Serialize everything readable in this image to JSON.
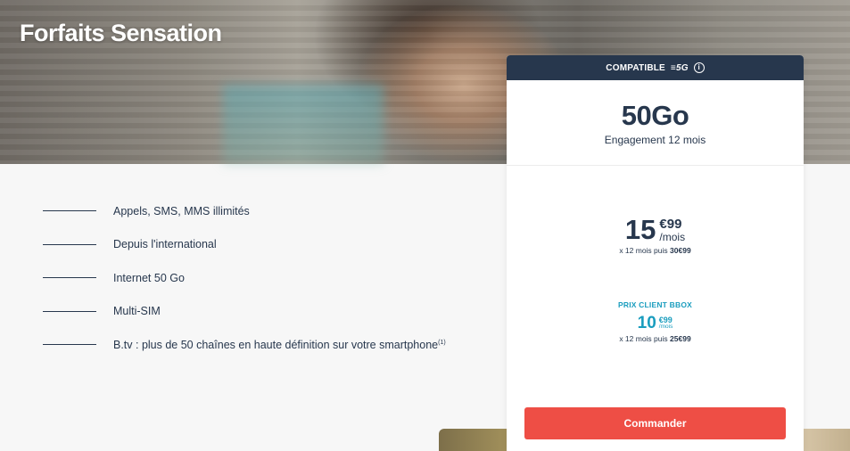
{
  "hero": {
    "title": "Forfaits Sensation"
  },
  "features": [
    {
      "label": "Appels, SMS, MMS illimités"
    },
    {
      "label": "Depuis l'international"
    },
    {
      "label": "Internet 50 Go"
    },
    {
      "label": "Multi-SIM"
    },
    {
      "label": "B.tv : plus de 50 chaînes en haute définition sur votre smartphone",
      "footnote": "(1)"
    }
  ],
  "card": {
    "header": {
      "compatible_label": "COMPATIBLE",
      "network_label": "≡5G",
      "info_icon": "i"
    },
    "data_amount": "50Go",
    "engagement": "Engagement 12 mois",
    "price": {
      "main": "15",
      "cents": "€99",
      "unit": "/mois",
      "note_prefix": "x 12 mois puis",
      "note_after": "30€99"
    },
    "client_price": {
      "label": "PRIX CLIENT BBOX",
      "main": "10",
      "cents": "€99",
      "unit": "/mois",
      "note_prefix": "x 12 mois puis",
      "note_after": "25€99"
    },
    "order_button": "Commander"
  },
  "colors": {
    "navy": "#27374d",
    "accent_red": "#ee4e45",
    "client_blue": "#1a9dbe",
    "background": "#f7f7f7"
  }
}
